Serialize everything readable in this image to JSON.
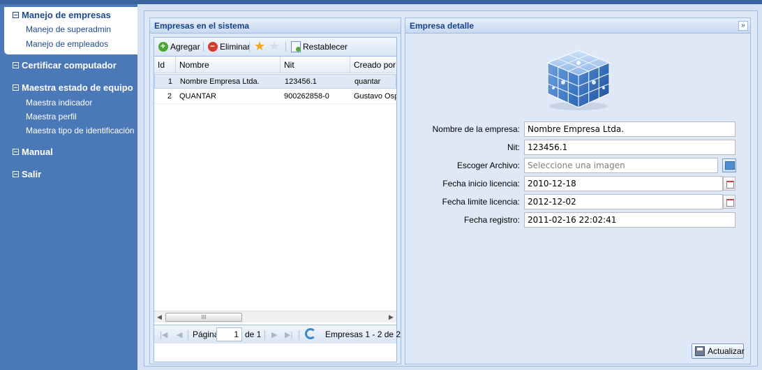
{
  "sidebar": {
    "groups": [
      {
        "label": "Manejo de empresas",
        "items": [
          "Manejo de superadmin",
          "Manejo de empleados"
        ]
      },
      {
        "label": "Certificar computador",
        "items": []
      },
      {
        "label": "Maestra estado de equipo",
        "items": [
          "Maestra indicador",
          "Maestra perfil",
          "Maestra tipo de identificación"
        ]
      },
      {
        "label": "Manual",
        "items": []
      },
      {
        "label": "Salir",
        "items": []
      }
    ]
  },
  "grid_panel": {
    "title": "Empresas en el sistema",
    "toolbar": {
      "add_label": "Agregar",
      "delete_label": "Eliminar",
      "reset_label": "Restablecer"
    },
    "columns": [
      "Id",
      "Nombre",
      "Nit",
      "Creado por"
    ],
    "rows": [
      {
        "id": "1",
        "nombre": "Nombre Empresa Ltda.",
        "nit": "123456.1",
        "creado_por": "quantar"
      },
      {
        "id": "2",
        "nombre": "QUANTAR",
        "nit": "900262858-0",
        "creado_por": "Gustavo Osp"
      }
    ],
    "selected_row": 0,
    "scroll_thumb_label": "III",
    "pager": {
      "page_label": "Página",
      "page_value": "1",
      "of_label": "de 1",
      "summary": "Empresas 1 - 2 de 2"
    }
  },
  "detail_panel": {
    "title": "Empresa detalle",
    "collapse_glyph": "»",
    "fields": {
      "nombre_label": "Nombre de la empresa:",
      "nombre_value": "Nombre Empresa Ltda.",
      "nit_label": "Nit:",
      "nit_value": "123456.1",
      "archivo_label": "Escoger Archivo:",
      "archivo_placeholder": "Seleccione una imagen",
      "inicio_label": "Fecha inicio licencia:",
      "inicio_value": "2010-12-18",
      "limite_label": "Fecha limite licencia:",
      "limite_value": "2012-12-02",
      "registro_label": "Fecha registro:",
      "registro_value": "2011-02-16 22:02:41"
    },
    "update_label": "Actualizar"
  },
  "colors": {
    "sidebar_bg": "#4b79b7",
    "header_text": "#15428b",
    "panel_border": "#99bbe8",
    "selected_row": "#dfe8f6"
  }
}
